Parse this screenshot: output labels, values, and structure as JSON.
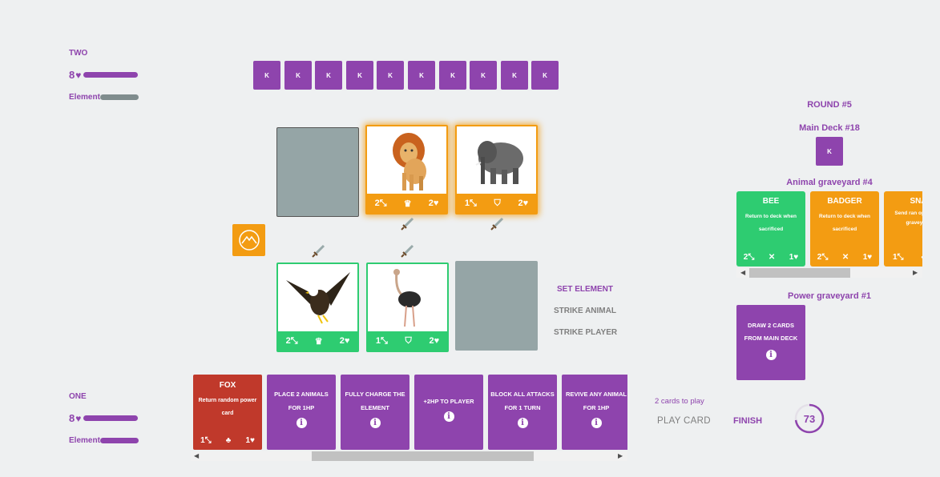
{
  "opponent": {
    "name": "TWO",
    "hp": "8",
    "element_label": "Element",
    "hand_cards": [
      "K",
      "K",
      "K",
      "K",
      "K",
      "K",
      "K",
      "K",
      "K",
      "K"
    ]
  },
  "player": {
    "name": "ONE",
    "hp": "8",
    "element_label": "Element"
  },
  "board": {
    "opponent_cards": [
      {
        "animal": "lion",
        "attack": "2",
        "ability": "crown-icon",
        "hp": "2"
      },
      {
        "animal": "elephant",
        "attack": "1",
        "ability": "shield-icon",
        "hp": "2"
      }
    ],
    "player_cards": [
      {
        "animal": "eagle",
        "attack": "2",
        "ability": "crown-icon",
        "hp": "2"
      },
      {
        "animal": "ostrich",
        "attack": "1",
        "ability": "shield-icon",
        "hp": "2"
      }
    ]
  },
  "actions": {
    "set_element": "SET ELEMENT",
    "strike_animal": "STRIKE ANIMAL",
    "strike_player": "STRIKE PLAYER",
    "cards_to_play": "2 cards to play",
    "play_card": "PLAY CARD",
    "finish": "FINISH",
    "timer": "73"
  },
  "side": {
    "round": "ROUND #5",
    "main_deck": "Main Deck #18",
    "main_deck_card": "K",
    "animal_graveyard": "Animal graveyard #4",
    "graveyard_cards": [
      {
        "name": "BEE",
        "desc": "Return to deck when sacrificed",
        "attack": "2",
        "hp": "1",
        "color": "#2ecc71"
      },
      {
        "name": "BADGER",
        "desc": "Return to deck when sacrificed",
        "attack": "2",
        "hp": "1",
        "color": "#f39c12"
      },
      {
        "name": "SNA",
        "desc": "Send ran opponent graveyard",
        "attack": "1",
        "hp": "",
        "color": "#f39c12"
      }
    ],
    "power_graveyard": "Power graveyard #1",
    "power_card": "DRAW 2 CARDS FROM MAIN DECK"
  },
  "hand": [
    {
      "title": "FOX",
      "desc": "Return random power card",
      "attack": "1",
      "hp": "1",
      "color": "#c0392b"
    },
    {
      "text": "PLACE 2 ANIMALS FOR 1HP"
    },
    {
      "text": "FULLY CHARGE THE ELEMENT"
    },
    {
      "text": "+2HP TO PLAYER"
    },
    {
      "text": "BLOCK ALL ATTACKS FOR 1 TURN"
    },
    {
      "text": "REVIVE ANY ANIMAL FOR 1HP"
    }
  ],
  "colors": {
    "purple": "#8e44ad",
    "orange": "#f39c12",
    "green": "#2ecc71",
    "red": "#c0392b",
    "slot": "#95a5a6",
    "background": "#eef0f1"
  }
}
